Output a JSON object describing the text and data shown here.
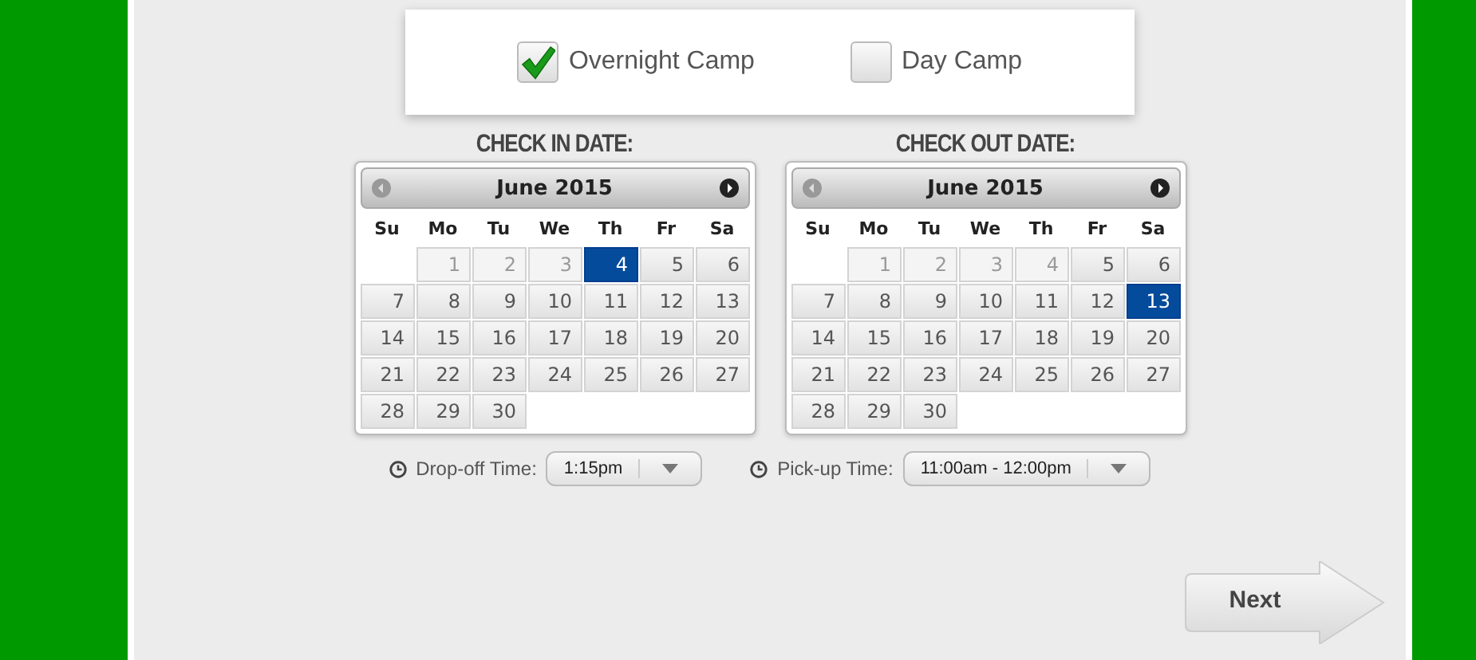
{
  "camp_types": [
    {
      "label": "Overnight Camp",
      "checked": true
    },
    {
      "label": "Day Camp",
      "checked": false
    }
  ],
  "calendars": [
    {
      "label": "CHECK IN DATE:",
      "month": "June 2015",
      "weekdays": [
        "Su",
        "Mo",
        "Tu",
        "We",
        "Th",
        "Fr",
        "Sa"
      ],
      "weeks": [
        [
          {
            "day": "1",
            "disabled": true,
            "selected": false
          },
          {
            "day": "2",
            "disabled": true,
            "selected": false
          },
          {
            "day": "3",
            "disabled": true,
            "selected": false
          },
          {
            "day": "4",
            "disabled": false,
            "selected": true
          },
          {
            "day": "5",
            "disabled": false,
            "selected": false
          },
          {
            "day": "6",
            "disabled": false,
            "selected": false
          }
        ],
        [
          {
            "day": "7",
            "disabled": false,
            "selected": false
          },
          {
            "day": "8",
            "disabled": false,
            "selected": false
          },
          {
            "day": "9",
            "disabled": false,
            "selected": false
          },
          {
            "day": "10",
            "disabled": false,
            "selected": false
          },
          {
            "day": "11",
            "disabled": false,
            "selected": false
          },
          {
            "day": "12",
            "disabled": false,
            "selected": false
          },
          {
            "day": "13",
            "disabled": false,
            "selected": false
          }
        ],
        [
          {
            "day": "14",
            "disabled": false,
            "selected": false
          },
          {
            "day": "15",
            "disabled": false,
            "selected": false
          },
          {
            "day": "16",
            "disabled": false,
            "selected": false
          },
          {
            "day": "17",
            "disabled": false,
            "selected": false
          },
          {
            "day": "18",
            "disabled": false,
            "selected": false
          },
          {
            "day": "19",
            "disabled": false,
            "selected": false
          },
          {
            "day": "20",
            "disabled": false,
            "selected": false
          }
        ],
        [
          {
            "day": "21",
            "disabled": false,
            "selected": false
          },
          {
            "day": "22",
            "disabled": false,
            "selected": false
          },
          {
            "day": "23",
            "disabled": false,
            "selected": false
          },
          {
            "day": "24",
            "disabled": false,
            "selected": false
          },
          {
            "day": "25",
            "disabled": false,
            "selected": false
          },
          {
            "day": "26",
            "disabled": false,
            "selected": false
          },
          {
            "day": "27",
            "disabled": false,
            "selected": false
          }
        ],
        [
          {
            "day": "28",
            "disabled": false,
            "selected": false
          },
          {
            "day": "29",
            "disabled": false,
            "selected": false
          },
          {
            "day": "30",
            "disabled": false,
            "selected": false
          }
        ]
      ]
    },
    {
      "label": "CHECK OUT DATE:",
      "month": "June 2015",
      "weekdays": [
        "Su",
        "Mo",
        "Tu",
        "We",
        "Th",
        "Fr",
        "Sa"
      ],
      "weeks": [
        [
          {
            "day": "1",
            "disabled": true,
            "selected": false
          },
          {
            "day": "2",
            "disabled": true,
            "selected": false
          },
          {
            "day": "3",
            "disabled": true,
            "selected": false
          },
          {
            "day": "4",
            "disabled": true,
            "selected": false
          },
          {
            "day": "5",
            "disabled": false,
            "selected": false
          },
          {
            "day": "6",
            "disabled": false,
            "selected": false
          }
        ],
        [
          {
            "day": "7",
            "disabled": false,
            "selected": false
          },
          {
            "day": "8",
            "disabled": false,
            "selected": false
          },
          {
            "day": "9",
            "disabled": false,
            "selected": false
          },
          {
            "day": "10",
            "disabled": false,
            "selected": false
          },
          {
            "day": "11",
            "disabled": false,
            "selected": false
          },
          {
            "day": "12",
            "disabled": false,
            "selected": false
          },
          {
            "day": "13",
            "disabled": false,
            "selected": true
          }
        ],
        [
          {
            "day": "14",
            "disabled": false,
            "selected": false
          },
          {
            "day": "15",
            "disabled": false,
            "selected": false
          },
          {
            "day": "16",
            "disabled": false,
            "selected": false
          },
          {
            "day": "17",
            "disabled": false,
            "selected": false
          },
          {
            "day": "18",
            "disabled": false,
            "selected": false
          },
          {
            "day": "19",
            "disabled": false,
            "selected": false
          },
          {
            "day": "20",
            "disabled": false,
            "selected": false
          }
        ],
        [
          {
            "day": "21",
            "disabled": false,
            "selected": false
          },
          {
            "day": "22",
            "disabled": false,
            "selected": false
          },
          {
            "day": "23",
            "disabled": false,
            "selected": false
          },
          {
            "day": "24",
            "disabled": false,
            "selected": false
          },
          {
            "day": "25",
            "disabled": false,
            "selected": false
          },
          {
            "day": "26",
            "disabled": false,
            "selected": false
          },
          {
            "day": "27",
            "disabled": false,
            "selected": false
          }
        ],
        [
          {
            "day": "28",
            "disabled": false,
            "selected": false
          },
          {
            "day": "29",
            "disabled": false,
            "selected": false
          },
          {
            "day": "30",
            "disabled": false,
            "selected": false
          }
        ]
      ]
    }
  ],
  "times": [
    {
      "label": "Drop-off Time:",
      "value": "1:15pm"
    },
    {
      "label": "Pick-up Time:",
      "value": "11:00am - 12:00pm"
    }
  ],
  "next_button": "Next"
}
